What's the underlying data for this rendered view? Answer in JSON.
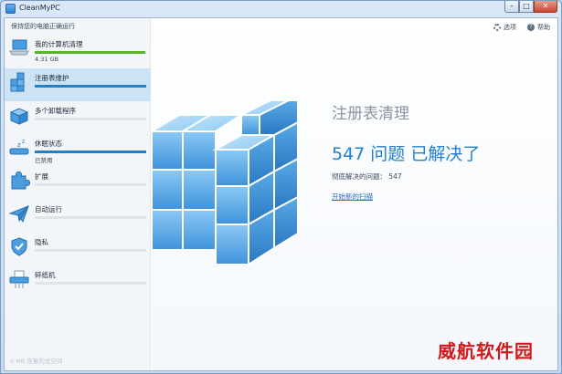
{
  "window": {
    "title": "CleanMyPC"
  },
  "sidebar": {
    "tagline": "保持您的电脑正确运行",
    "items": [
      {
        "label": "我的计算机清理",
        "sub": "4.31 GB",
        "fill": 0.99,
        "color": "#5cb32b",
        "icon": "laptop-icon"
      },
      {
        "label": "注册表维护",
        "sub": "",
        "fill": 1.0,
        "color": "#1f7fd1",
        "icon": "registry-cubes-icon"
      },
      {
        "label": "多个卸载程序",
        "sub": "",
        "fill": 0,
        "color": "#1f7fd1",
        "icon": "box-icon"
      },
      {
        "label": "休眠状态",
        "sub": "已禁用",
        "fill": 1.0,
        "color": "#1f7fd1",
        "icon": "sleep-icon"
      },
      {
        "label": "扩展",
        "sub": "",
        "fill": 0,
        "color": "#1f7fd1",
        "icon": "puzzle-icon"
      },
      {
        "label": "自动运行",
        "sub": "",
        "fill": 0,
        "color": "#1f7fd1",
        "icon": "paper-plane-icon"
      },
      {
        "label": "隐私",
        "sub": "",
        "fill": 0,
        "color": "#1f7fd1",
        "icon": "shield-icon"
      },
      {
        "label": "碎纸机",
        "sub": "",
        "fill": 0,
        "color": "#1f7fd1",
        "icon": "shredder-icon"
      }
    ],
    "footer": "0 MB 恢复的总空间"
  },
  "header": {
    "options": "选项",
    "help": "帮助"
  },
  "main": {
    "heading": "注册表清理",
    "result": "547 问题 已解决了",
    "detail": "彻底解决的问题： 547",
    "scan_link": "开始新的扫描"
  },
  "watermark": "威航软件园"
}
